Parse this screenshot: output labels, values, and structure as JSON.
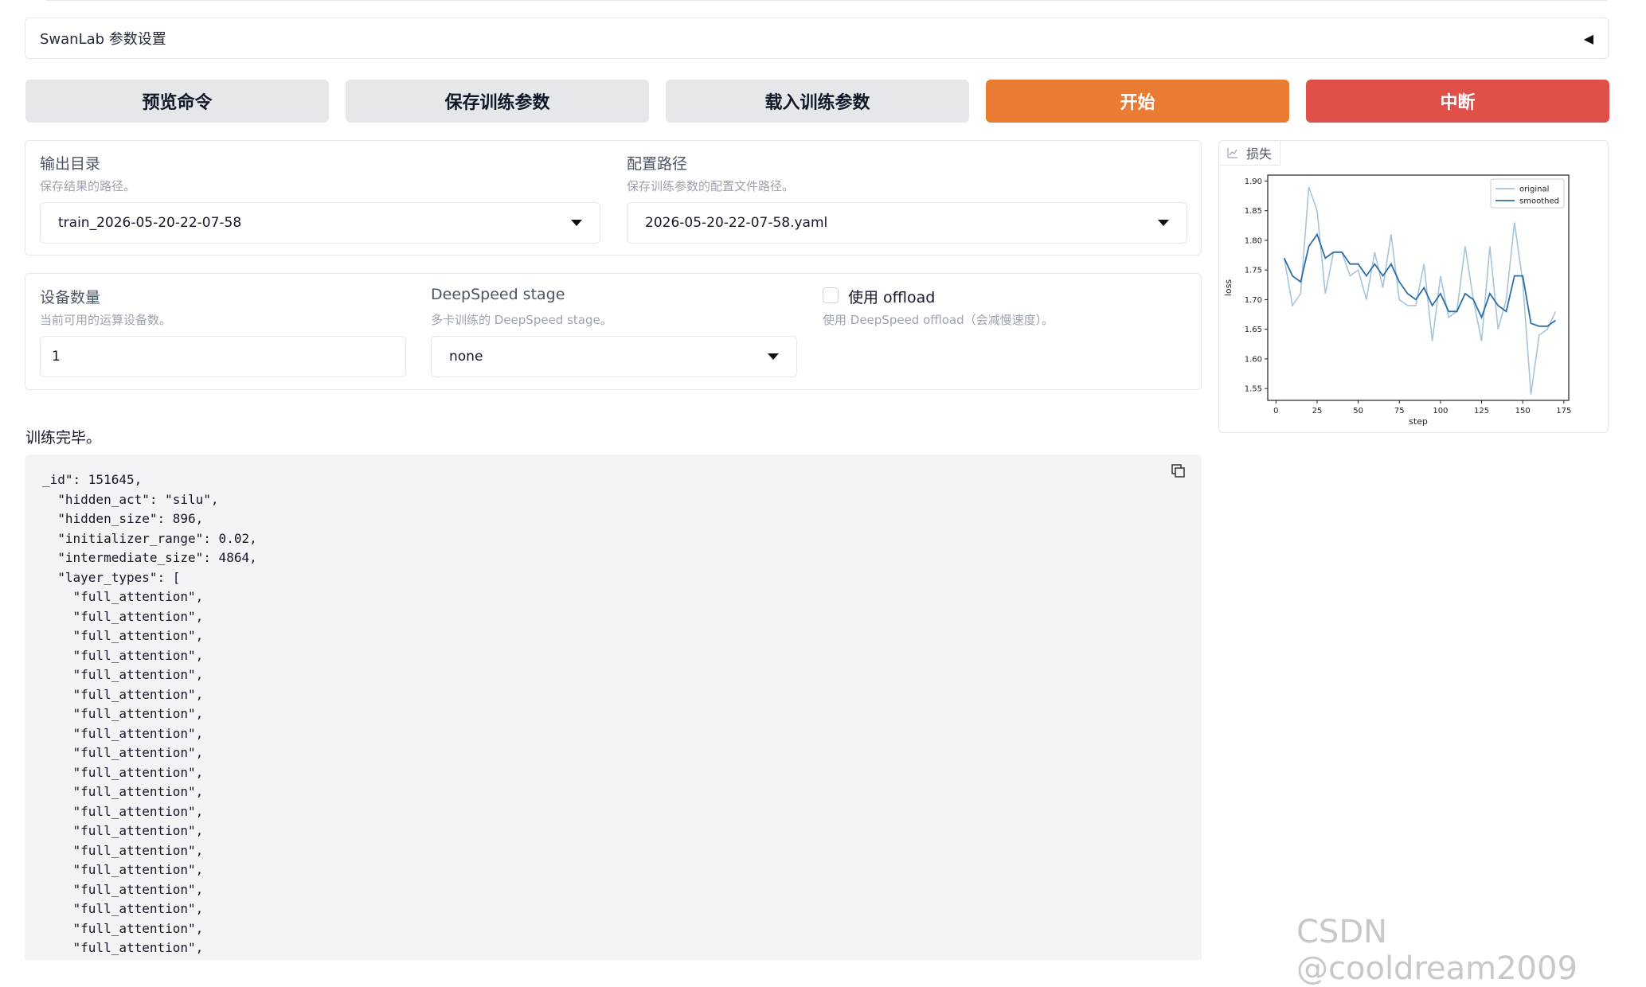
{
  "accordion": {
    "title": "SwanLab 参数设置",
    "arrow": "◀"
  },
  "buttons": {
    "preview": "预览命令",
    "save": "保存训练参数",
    "load": "载入训练参数",
    "start": "开始",
    "abort": "中断"
  },
  "output_dir": {
    "label": "输出目录",
    "info": "保存结果的路径。",
    "value": "train_2026-05-20-22-07-58"
  },
  "config_path": {
    "label": "配置路径",
    "info": "保存训练参数的配置文件路径。",
    "value": "2026-05-20-22-07-58.yaml"
  },
  "device_count": {
    "label": "设备数量",
    "info": "当前可用的运算设备数。",
    "value": "1"
  },
  "ds_stage": {
    "label": "DeepSpeed stage",
    "info": "多卡训练的 DeepSpeed stage。",
    "value": "none"
  },
  "ds_offload": {
    "label": "使用 offload",
    "info": "使用 DeepSpeed offload（会减慢速度）。",
    "checked": false
  },
  "status": "训练完毕。",
  "code_output": "_id\": 151645,\n  \"hidden_act\": \"silu\",\n  \"hidden_size\": 896,\n  \"initializer_range\": 0.02,\n  \"intermediate_size\": 4864,\n  \"layer_types\": [\n    \"full_attention\",\n    \"full_attention\",\n    \"full_attention\",\n    \"full_attention\",\n    \"full_attention\",\n    \"full_attention\",\n    \"full_attention\",\n    \"full_attention\",\n    \"full_attention\",\n    \"full_attention\",\n    \"full_attention\",\n    \"full_attention\",\n    \"full_attention\",\n    \"full_attention\",\n    \"full_attention\",\n    \"full_attention\",\n    \"full_attention\",\n    \"full_attention\",\n    \"full_attention\",\n    \"full_attention\",",
  "plot_tab": {
    "label": "损失",
    "icon": "chart-icon"
  },
  "chart_data": {
    "type": "line",
    "xlabel": "step",
    "ylabel": "loss",
    "xlim": [
      -5,
      178
    ],
    "ylim": [
      1.53,
      1.91
    ],
    "xticks": [
      0,
      25,
      50,
      75,
      100,
      125,
      150,
      175
    ],
    "yticks": [
      1.55,
      1.6,
      1.65,
      1.7,
      1.75,
      1.8,
      1.85,
      1.9
    ],
    "legend": "top-right",
    "series": [
      {
        "name": "original",
        "color": "#a6c5dc",
        "x": [
          5,
          10,
          15,
          20,
          25,
          30,
          35,
          40,
          45,
          50,
          55,
          60,
          65,
          70,
          75,
          80,
          85,
          90,
          95,
          100,
          105,
          110,
          115,
          120,
          125,
          130,
          135,
          140,
          145,
          150,
          155,
          160,
          165,
          170
        ],
        "y": [
          1.77,
          1.69,
          1.71,
          1.89,
          1.85,
          1.71,
          1.78,
          1.78,
          1.74,
          1.75,
          1.7,
          1.78,
          1.72,
          1.81,
          1.7,
          1.69,
          1.69,
          1.76,
          1.63,
          1.74,
          1.67,
          1.68,
          1.79,
          1.7,
          1.63,
          1.79,
          1.65,
          1.7,
          1.83,
          1.73,
          1.54,
          1.64,
          1.65,
          1.68
        ]
      },
      {
        "name": "smoothed",
        "color": "#2e6ea6",
        "x": [
          5,
          10,
          15,
          20,
          25,
          30,
          35,
          40,
          45,
          50,
          55,
          60,
          65,
          70,
          75,
          80,
          85,
          90,
          95,
          100,
          105,
          110,
          115,
          120,
          125,
          130,
          135,
          140,
          145,
          150,
          155,
          160,
          165,
          170
        ],
        "y": [
          1.77,
          1.74,
          1.73,
          1.79,
          1.81,
          1.77,
          1.78,
          1.78,
          1.76,
          1.76,
          1.74,
          1.76,
          1.74,
          1.76,
          1.73,
          1.71,
          1.7,
          1.72,
          1.69,
          1.71,
          1.68,
          1.68,
          1.71,
          1.7,
          1.67,
          1.71,
          1.69,
          1.68,
          1.74,
          1.74,
          1.66,
          1.655,
          1.655,
          1.665
        ]
      }
    ]
  }
}
